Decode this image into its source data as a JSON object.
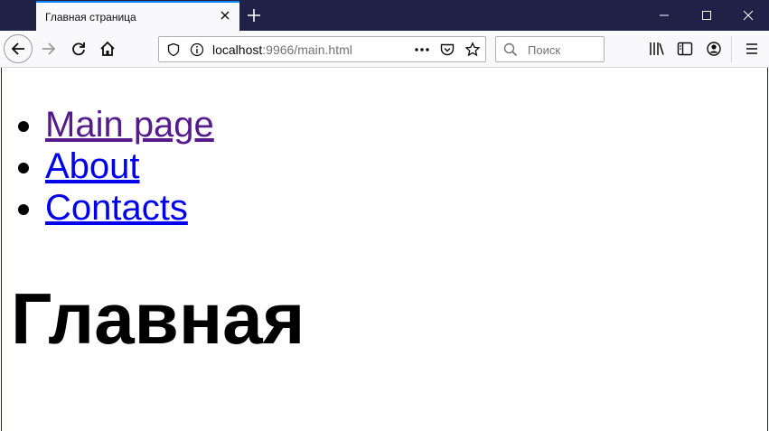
{
  "browser": {
    "tab": {
      "title": "Главная страница"
    },
    "address_bar": {
      "host": "localhost",
      "path": ":9966/main.html"
    },
    "search_bar": {
      "placeholder": "Поиск"
    }
  },
  "page": {
    "nav_links": [
      {
        "label": "Main page"
      },
      {
        "label": "About"
      },
      {
        "label": "Contacts"
      }
    ],
    "heading": "Главная"
  },
  "colors": {
    "titlebar": "#1f2146",
    "tab_accent": "#0a84ff",
    "link": "#0000ee",
    "visited_link": "#551a8b"
  },
  "icons": [
    "close-icon",
    "plus-icon",
    "minimize-icon",
    "maximize-icon",
    "back-arrow-icon",
    "forward-arrow-icon",
    "reload-icon",
    "home-icon",
    "shield-icon",
    "info-icon",
    "more-dots-icon",
    "pocket-icon",
    "star-icon",
    "search-icon",
    "library-icon",
    "sidebar-icon",
    "account-icon",
    "hamburger-menu-icon"
  ]
}
